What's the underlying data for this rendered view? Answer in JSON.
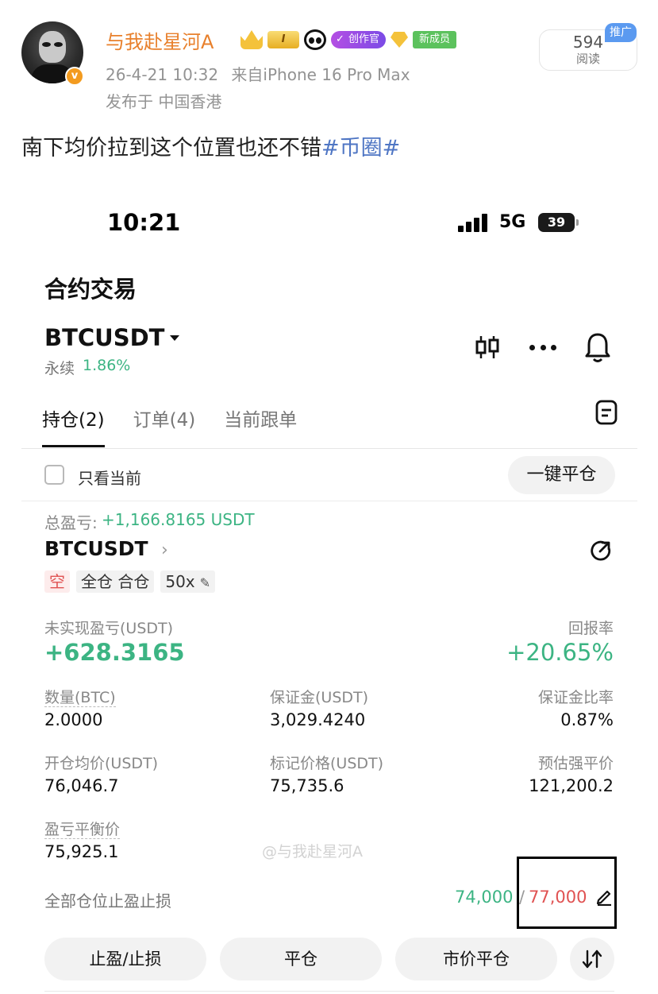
{
  "post": {
    "username": "与我赴星河A",
    "level_badge": "I",
    "creator_badge": "创作官",
    "new_member_badge": "新成员",
    "timestamp": "26-4-21 10:32",
    "device": "来自iPhone 16 Pro Max",
    "location": "发布于 中国香港",
    "views_count": "594",
    "views_label": "阅读",
    "promo_label": "推广",
    "text": "南下均价拉到这个位置也还不错",
    "hashtag": "#币圈#",
    "verified_mark": "v"
  },
  "status_bar": {
    "time": "10:21",
    "network": "5G",
    "battery": "39"
  },
  "app": {
    "page_title": "合约交易",
    "symbol": "BTCUSDT",
    "contract_type": "永续",
    "change_pct": "1.86%",
    "tabs": [
      {
        "label": "持仓(2)",
        "active": true
      },
      {
        "label": "订单(4)",
        "active": false
      },
      {
        "label": "当前跟单",
        "active": false
      }
    ],
    "only_current_label": "只看当前",
    "close_all_label": "一键平仓",
    "total_pnl_label": "总盈亏:",
    "total_pnl_value": "+1,166.8165 USDT",
    "position": {
      "symbol": "BTCUSDT",
      "side": "空",
      "margin_mode": "全仓 合仓",
      "leverage": "50x",
      "unrealized_label": "未实现盈亏(USDT)",
      "unrealized_value": "+628.3165",
      "roe_label": "回报率",
      "roe_value": "+20.65%",
      "fields": {
        "qty_label": "数量(BTC)",
        "qty_value": "2.0000",
        "margin_label": "保证金(USDT)",
        "margin_value": "3,029.4240",
        "margin_ratio_label": "保证金比率",
        "margin_ratio_value": "0.87%",
        "entry_label": "开仓均价(USDT)",
        "entry_value": "76,046.7",
        "mark_label": "标记价格(USDT)",
        "mark_value": "75,735.6",
        "liq_label": "预估强平价",
        "liq_value": "121,200.2",
        "breakeven_label": "盈亏平衡价",
        "breakeven_value": "75,925.1"
      },
      "tpsl_label": "全部仓位止盈止损",
      "tp_value": "74,000",
      "sl_value": "77,000"
    },
    "watermark": "@与我赴星河A",
    "buttons": {
      "tpsl": "止盈/止损",
      "close": "平仓",
      "market_close": "市价平仓"
    }
  },
  "colors": {
    "green": "#3cb483",
    "red": "#e05252",
    "username_orange": "#e8802c",
    "hashtag_blue": "#4f76c4"
  }
}
